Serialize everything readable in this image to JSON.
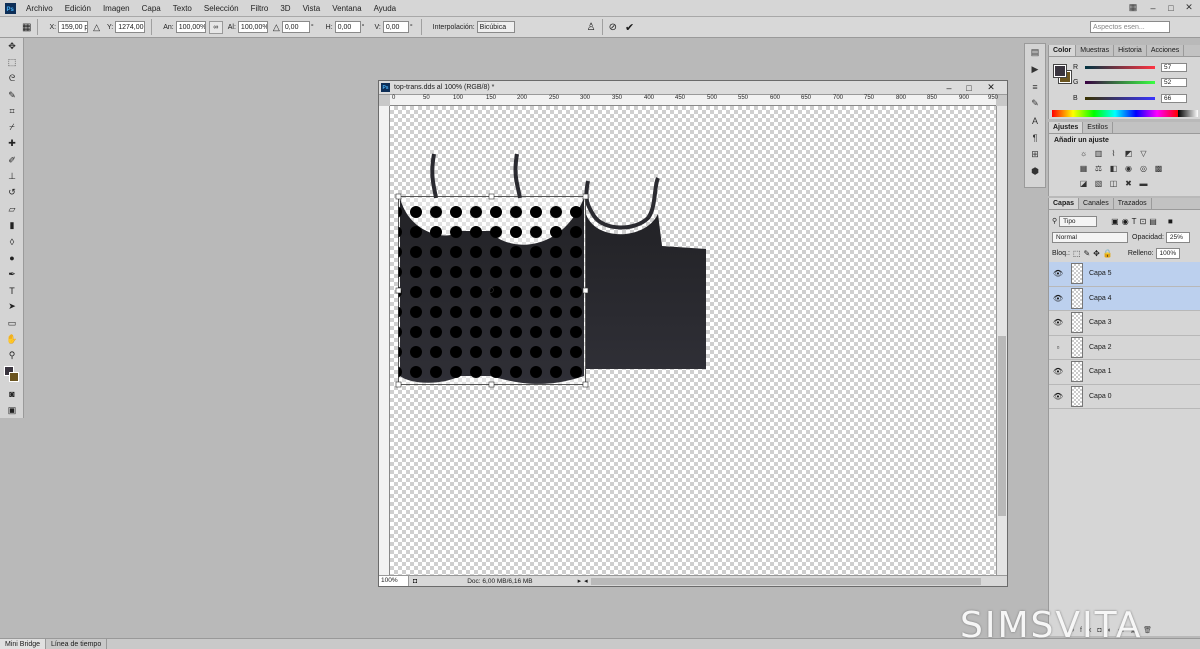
{
  "app": {
    "menu": [
      "Archivo",
      "Edición",
      "Imagen",
      "Capa",
      "Texto",
      "Selección",
      "Filtro",
      "3D",
      "Vista",
      "Ventana",
      "Ayuda"
    ],
    "workspace_search_placeholder": "Aspectos esen..."
  },
  "options_bar": {
    "x_label": "X:",
    "x_value": "159,00 px",
    "y_label": "Y:",
    "y_value": "1274,00 p",
    "w_label": "An:",
    "w_value": "100,00%",
    "h_label": "Al:",
    "h_value": "100,00%",
    "angle_value": "0,00",
    "hskew_label": "H:",
    "hskew_value": "0,00",
    "vskew_label": "V:",
    "vskew_value": "0,00",
    "degree": "°",
    "interp_label": "Interpolación:",
    "interp_value": "Bicúbica"
  },
  "document": {
    "title": "top-trans.dds al 100% (RGB/8) *",
    "zoom": "100%",
    "doc_info": "Doc: 6,00 MB/6,16 MB",
    "ruler_top": [
      "0",
      "50",
      "100",
      "150",
      "200",
      "250",
      "300",
      "350",
      "400",
      "450",
      "500",
      "550",
      "600",
      "650",
      "700",
      "750",
      "800",
      "850",
      "900",
      "950"
    ]
  },
  "color_panel": {
    "tabs": [
      "Color",
      "Muestras",
      "Historia",
      "Acciones"
    ],
    "r_label": "R",
    "r_value": "57",
    "g_label": "G",
    "g_value": "52",
    "b_label": "B",
    "b_value": "66",
    "fg_color": "#39343e",
    "bg_color": "#6b5520"
  },
  "adjustments_panel": {
    "tabs": [
      "Ajustes",
      "Estilos"
    ],
    "title": "Añadir un ajuste"
  },
  "layers_panel": {
    "tabs": [
      "Capas",
      "Canales",
      "Trazados"
    ],
    "filter_value": "Tipo",
    "blend_mode": "Normal",
    "opacity_label": "Opacidad:",
    "opacity_value": "25%",
    "lock_label": "Bloq.:",
    "fill_label": "Relleno:",
    "fill_value": "100%",
    "layers": [
      {
        "name": "Capa 5",
        "visible": true,
        "selected": true
      },
      {
        "name": "Capa 4",
        "visible": true,
        "selected": true
      },
      {
        "name": "Capa 3",
        "visible": true,
        "selected": false
      },
      {
        "name": "Capa 2",
        "visible": false,
        "selected": false
      },
      {
        "name": "Capa 1",
        "visible": true,
        "selected": false
      },
      {
        "name": "Capa 0",
        "visible": true,
        "selected": false
      }
    ]
  },
  "bottom_tabs": [
    "Mini Bridge",
    "Línea de tiempo"
  ],
  "watermark": "SIMSVITA"
}
